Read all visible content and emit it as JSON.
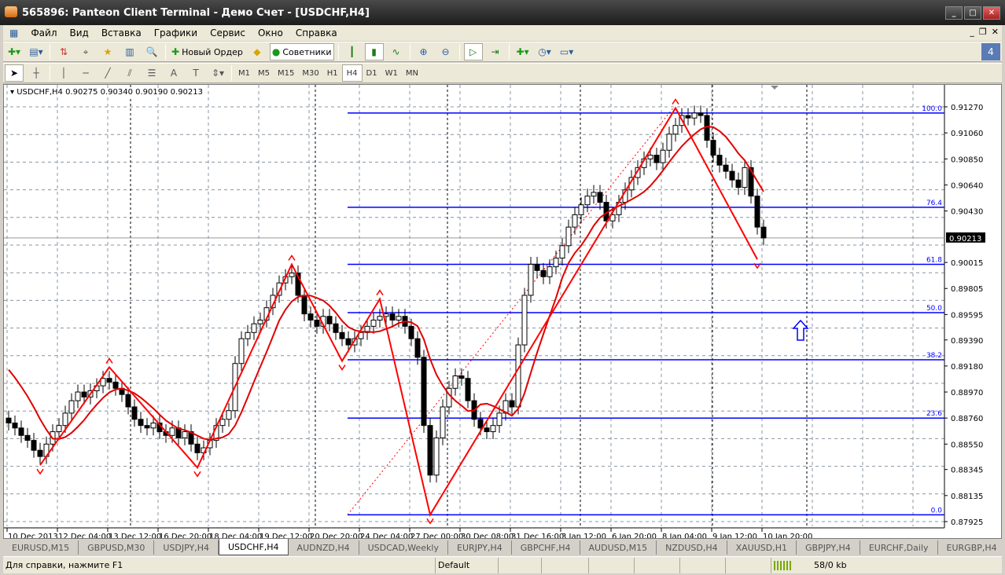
{
  "window": {
    "title": "565896: Panteon Client Terminal - Демо Счет - [USDCHF,H4]",
    "buttons": [
      "_",
      "□",
      "✕"
    ],
    "mdi_buttons": [
      "_",
      "❐",
      "✕"
    ]
  },
  "menu": [
    "Файл",
    "Вид",
    "Вставка",
    "Графики",
    "Сервис",
    "Окно",
    "Справка"
  ],
  "toolbar": {
    "new_order": "Новый Ордер",
    "experts": "Советники"
  },
  "timeframes": [
    "M1",
    "M5",
    "M15",
    "M30",
    "H1",
    "H4",
    "D1",
    "W1",
    "MN"
  ],
  "active_timeframe": "H4",
  "chart": {
    "header": "USDCHF,H4  0.90275 0.90340 0.90190 0.90213",
    "price_labels": [
      "0.91270",
      "0.91060",
      "0.90850",
      "0.90640",
      "0.90430",
      "0.90015",
      "0.89805",
      "0.89595",
      "0.89390",
      "0.89180",
      "0.88970",
      "0.88760",
      "0.88550",
      "0.88345",
      "0.88135",
      "0.87925"
    ],
    "current_price": "0.90213",
    "time_labels": [
      "10 Dec 2013",
      "12 Dec 04:00",
      "13 Dec 12:00",
      "16 Dec 20:00",
      "18 Dec 04:00",
      "19 Dec 12:00",
      "20 Dec 20:00",
      "24 Dec 04:00",
      "27 Dec 00:00",
      "30 Dec 08:00",
      "31 Dec 16:00",
      "3 Jan 12:00",
      "6 Jan 20:00",
      "8 Jan 04:00",
      "9 Jan 12:00",
      "10 Jan 20:00"
    ],
    "fib_levels": [
      {
        "label": "100.0",
        "price": 0.9122
      },
      {
        "label": "76.4",
        "price": 0.9046
      },
      {
        "label": "61.8",
        "price": 0.9
      },
      {
        "label": "50.0",
        "price": 0.8961
      },
      {
        "label": "38.2",
        "price": 0.8923
      },
      {
        "label": "23.6",
        "price": 0.8876
      },
      {
        "label": "0.0",
        "price": 0.8798
      }
    ],
    "closes": [
      0.8872,
      0.8868,
      0.8862,
      0.8858,
      0.885,
      0.8845,
      0.8855,
      0.8865,
      0.887,
      0.888,
      0.889,
      0.8897,
      0.8893,
      0.8898,
      0.8902,
      0.8908,
      0.8905,
      0.89,
      0.8895,
      0.8885,
      0.8875,
      0.887,
      0.8868,
      0.8872,
      0.8865,
      0.8862,
      0.8868,
      0.886,
      0.8865,
      0.8855,
      0.8848,
      0.8852,
      0.8858,
      0.887,
      0.8875,
      0.8882,
      0.892,
      0.894,
      0.8945,
      0.8952,
      0.8955,
      0.8965,
      0.8975,
      0.8985,
      0.899,
      0.8993,
      0.8975,
      0.896,
      0.8955,
      0.895,
      0.8958,
      0.8952,
      0.8945,
      0.894,
      0.8935,
      0.894,
      0.8945,
      0.895,
      0.8955,
      0.8958,
      0.896,
      0.8955,
      0.8958,
      0.895,
      0.894,
      0.8925,
      0.887,
      0.883,
      0.886,
      0.8885,
      0.89,
      0.891,
      0.8908,
      0.889,
      0.8875,
      0.8868,
      0.8865,
      0.887,
      0.888,
      0.889,
      0.8885,
      0.8935,
      0.8975,
      0.9,
      0.8995,
      0.899,
      0.8998,
      0.9005,
      0.9015,
      0.903,
      0.904,
      0.9048,
      0.9055,
      0.9058,
      0.905,
      0.9035,
      0.904,
      0.905,
      0.906,
      0.907,
      0.9078,
      0.9085,
      0.9088,
      0.9082,
      0.9092,
      0.9105,
      0.9112,
      0.912,
      0.9118,
      0.9122,
      0.912,
      0.91,
      0.9088,
      0.908,
      0.9075,
      0.9068,
      0.9062,
      0.9078,
      0.9055,
      0.903,
      0.90213
    ],
    "zigzag": [
      [
        5,
        0.8838
      ],
      [
        16,
        0.8917
      ],
      [
        30,
        0.8836
      ],
      [
        45,
        0.9
      ],
      [
        53,
        0.8922
      ],
      [
        59,
        0.8972
      ],
      [
        67,
        0.8798
      ],
      [
        106,
        0.9126
      ],
      [
        119,
        0.9004
      ]
    ],
    "colors": {
      "candle": "#000000",
      "zigzag": "#ff0000",
      "ma": "#e00000",
      "fib": "#0000ff",
      "grid": "#8a94a0"
    }
  },
  "tabs": [
    "EURUSD,M15",
    "GBPUSD,M30",
    "USDJPY,H4",
    "USDCHF,H4",
    "AUDNZD,H4",
    "USDCAD,Weekly",
    "EURJPY,H4",
    "GBPCHF,H4",
    "AUDUSD,M15",
    "NZDUSD,H4",
    "XAUUSD,H1",
    "GBPJPY,H4",
    "EURCHF,Daily",
    "EURGBP,H4"
  ],
  "active_tab": "USDCHF,H4",
  "status": {
    "help": "Для справки, нажмите F1",
    "profile": "Default",
    "traffic": "58/0 kb"
  }
}
